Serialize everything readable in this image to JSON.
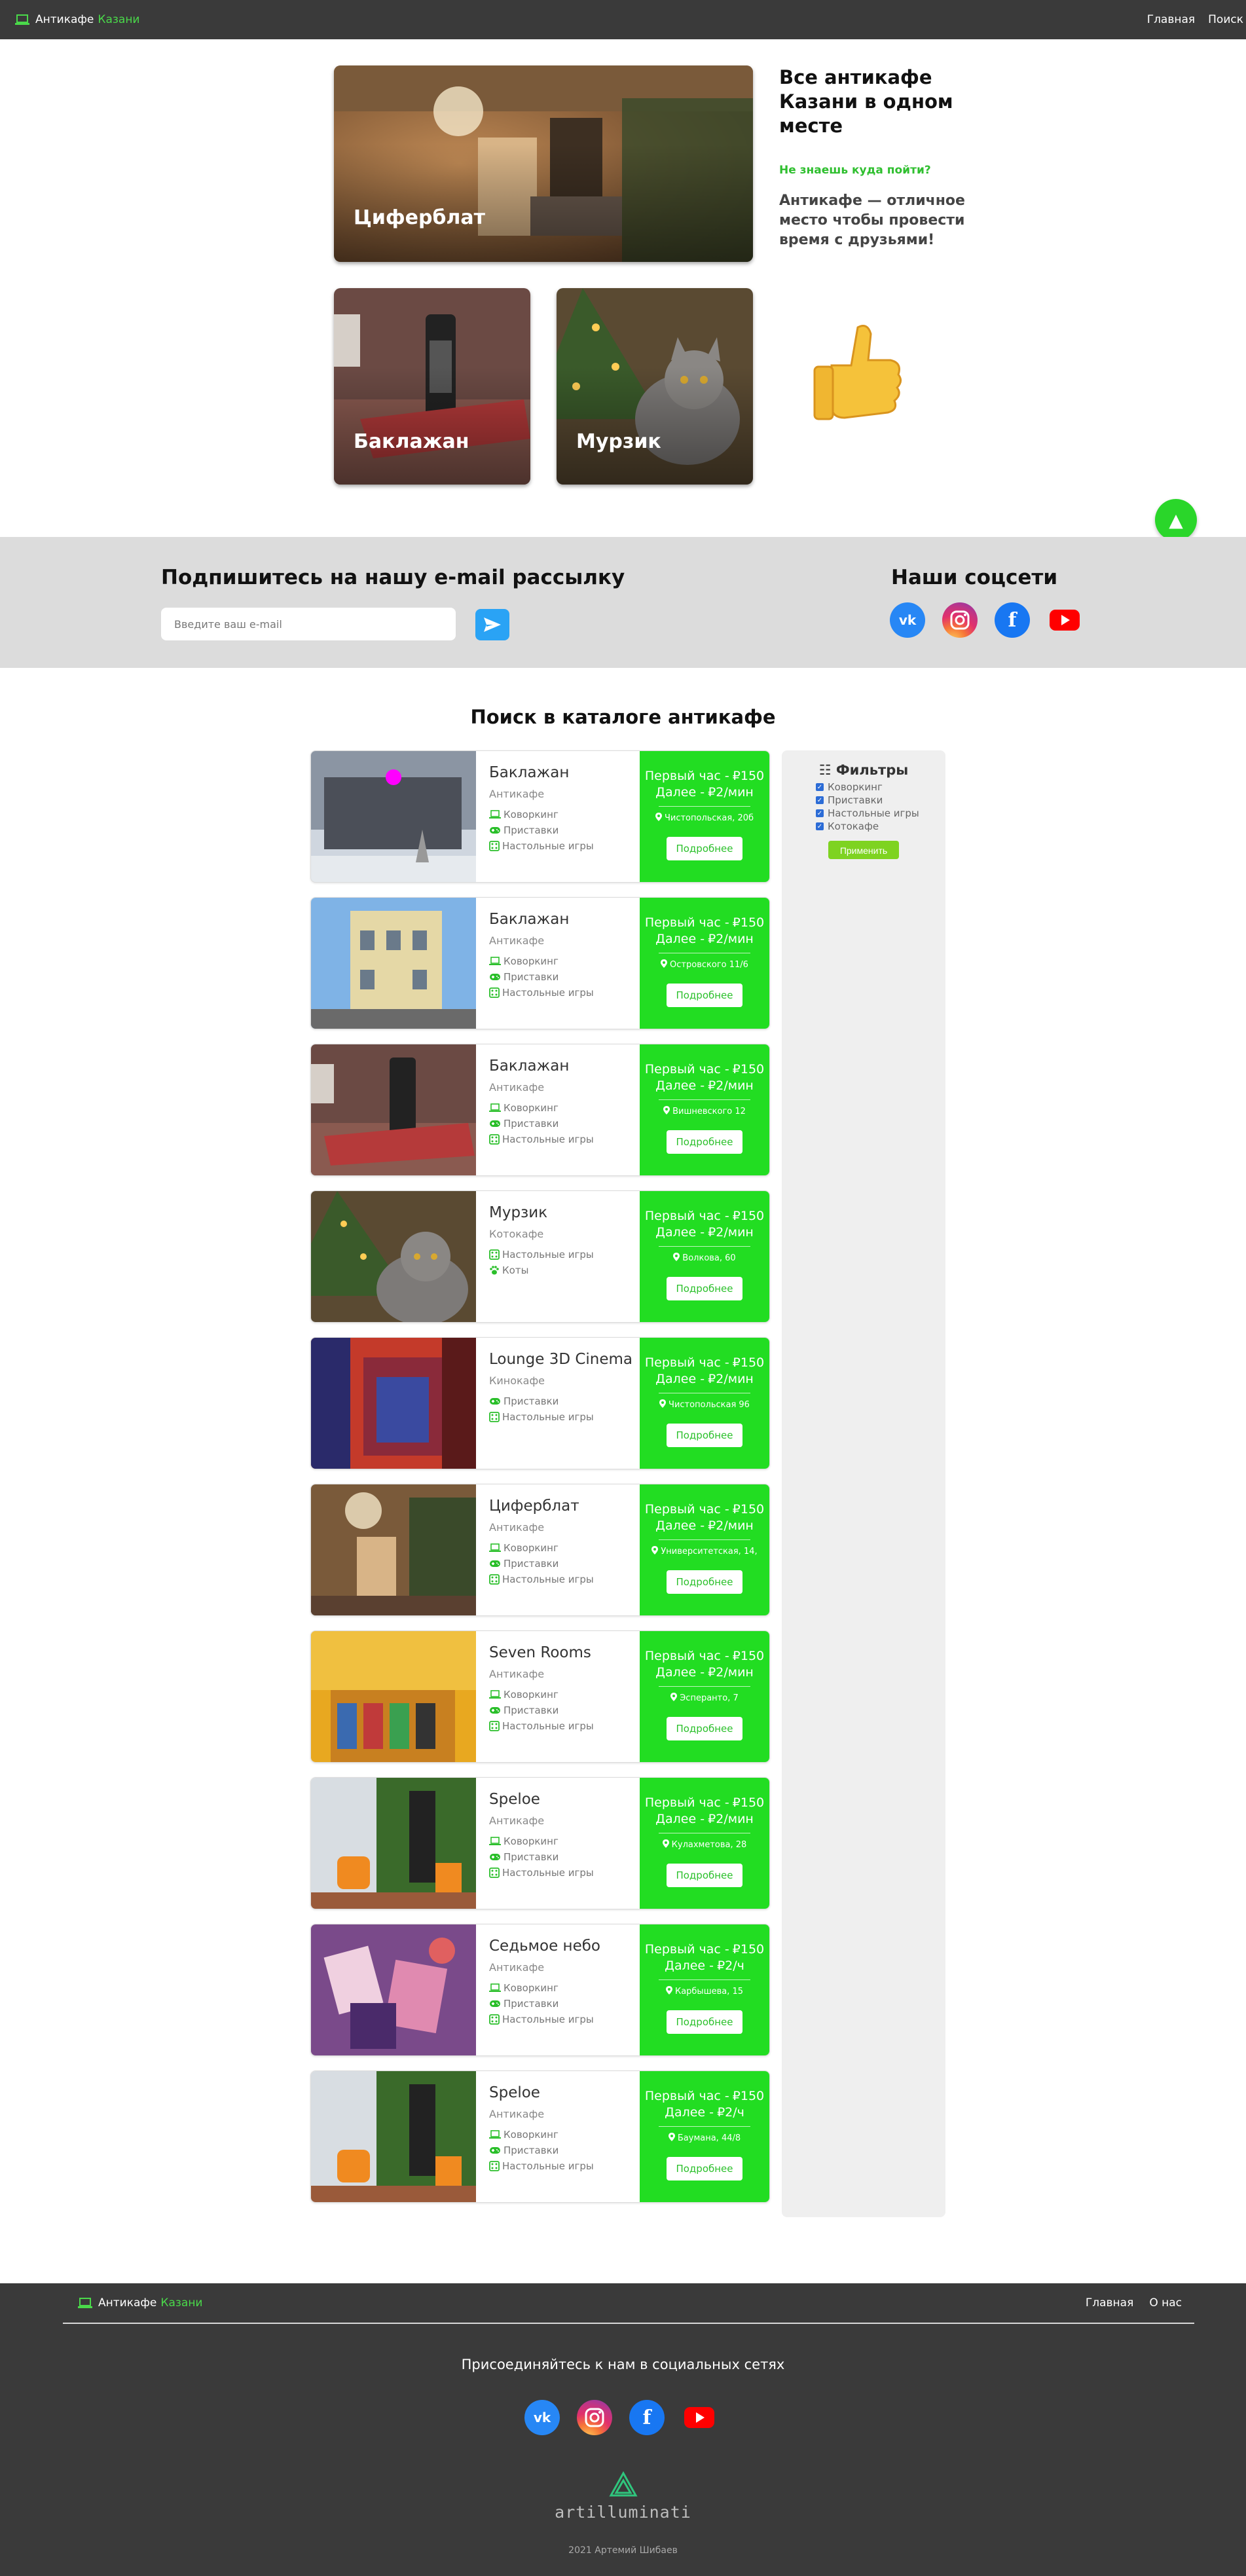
{
  "nav": {
    "brand_main": "Антикафе",
    "brand_accent": "Казани",
    "links": [
      "Главная",
      "Поиск"
    ]
  },
  "hero": {
    "title": "Все антикафе Казани в одном месте",
    "question": "Не знаешь куда пойти?",
    "subtitle": "Антикафе — отличное место чтобы провести время с друзьями!",
    "tiles": [
      "Циферблат",
      "Баклажан",
      "Мурзик"
    ],
    "thumb_icon": "thumbs-up-icon",
    "to_top_icon": "arrow-up-icon"
  },
  "subscribe": {
    "title": "Подпишитесь на нашу e-mail рассылку",
    "placeholder": "Введите ваш e-mail",
    "send_icon": "paper-plane-icon",
    "socials_title": "Наши соцсети",
    "socials": [
      "vk-icon",
      "instagram-icon",
      "facebook-icon",
      "youtube-icon"
    ]
  },
  "catalog": {
    "title": "Поиск в каталоге антикафе",
    "price_first_label": "Первый час -",
    "price_next_label": "Далее -",
    "more_label": "Подробнее",
    "cards": [
      {
        "name": "Баклажан",
        "type": "Антикафе",
        "features": [
          "Коворкинг",
          "Приставки",
          "Настольные игры"
        ],
        "first": "₽150",
        "next": "₽2/мин",
        "address": "Чистопольская, 20б"
      },
      {
        "name": "Баклажан",
        "type": "Антикафе",
        "features": [
          "Коворкинг",
          "Приставки",
          "Настольные игры"
        ],
        "first": "₽150",
        "next": "₽2/мин",
        "address": "Островского 11/6"
      },
      {
        "name": "Баклажан",
        "type": "Антикафе",
        "features": [
          "Коворкинг",
          "Приставки",
          "Настольные игры"
        ],
        "first": "₽150",
        "next": "₽2/мин",
        "address": "Вишневского 12"
      },
      {
        "name": "Мурзик",
        "type": "Котокафе",
        "features": [
          "Настольные игры",
          "Коты"
        ],
        "first": "₽150",
        "next": "₽2/мин",
        "address": "Волкова, 60"
      },
      {
        "name": "Lounge 3D Cinema",
        "type": "Кинокафе",
        "features": [
          "Приставки",
          "Настольные игры"
        ],
        "first": "₽150",
        "next": "₽2/мин",
        "address": "Чистопольская 96"
      },
      {
        "name": "Циферблат",
        "type": "Антикафе",
        "features": [
          "Коворкинг",
          "Приставки",
          "Настольные игры"
        ],
        "first": "₽150",
        "next": "₽2/мин",
        "address": "Университетская, 14,"
      },
      {
        "name": "Seven Rooms",
        "type": "Антикафе",
        "features": [
          "Коворкинг",
          "Приставки",
          "Настольные игры"
        ],
        "first": "₽150",
        "next": "₽2/мин",
        "address": "Эсперанто, 7"
      },
      {
        "name": "Speloe",
        "type": "Антикафе",
        "features": [
          "Коворкинг",
          "Приставки",
          "Настольные игры"
        ],
        "first": "₽150",
        "next": "₽2/мин",
        "address": "Кулахметова, 28"
      },
      {
        "name": "Седьмое небо",
        "type": "Антикафе",
        "features": [
          "Коворкинг",
          "Приставки",
          "Настольные игры"
        ],
        "first": "₽150",
        "next": "₽2/ч",
        "address": "Карбышева, 15"
      },
      {
        "name": "Speloe",
        "type": "Антикафе",
        "features": [
          "Коворкинг",
          "Приставки",
          "Настольные игры"
        ],
        "first": "₽150",
        "next": "₽2/ч",
        "address": "Баумана, 44/8"
      }
    ]
  },
  "filters": {
    "title": "Фильтры",
    "options": [
      "Коворкинг",
      "Приставки",
      "Настольные игры",
      "Котокафе"
    ],
    "apply_label": "Применить"
  },
  "footer": {
    "brand_main": "Антикафе",
    "brand_accent": "Казани",
    "links": [
      "Главная",
      "О нас"
    ],
    "join": "Присоединяйтесь к нам в социальных сетях",
    "logo_text": "artilluminati",
    "copyright": "2021 Артемий Шибаев"
  }
}
